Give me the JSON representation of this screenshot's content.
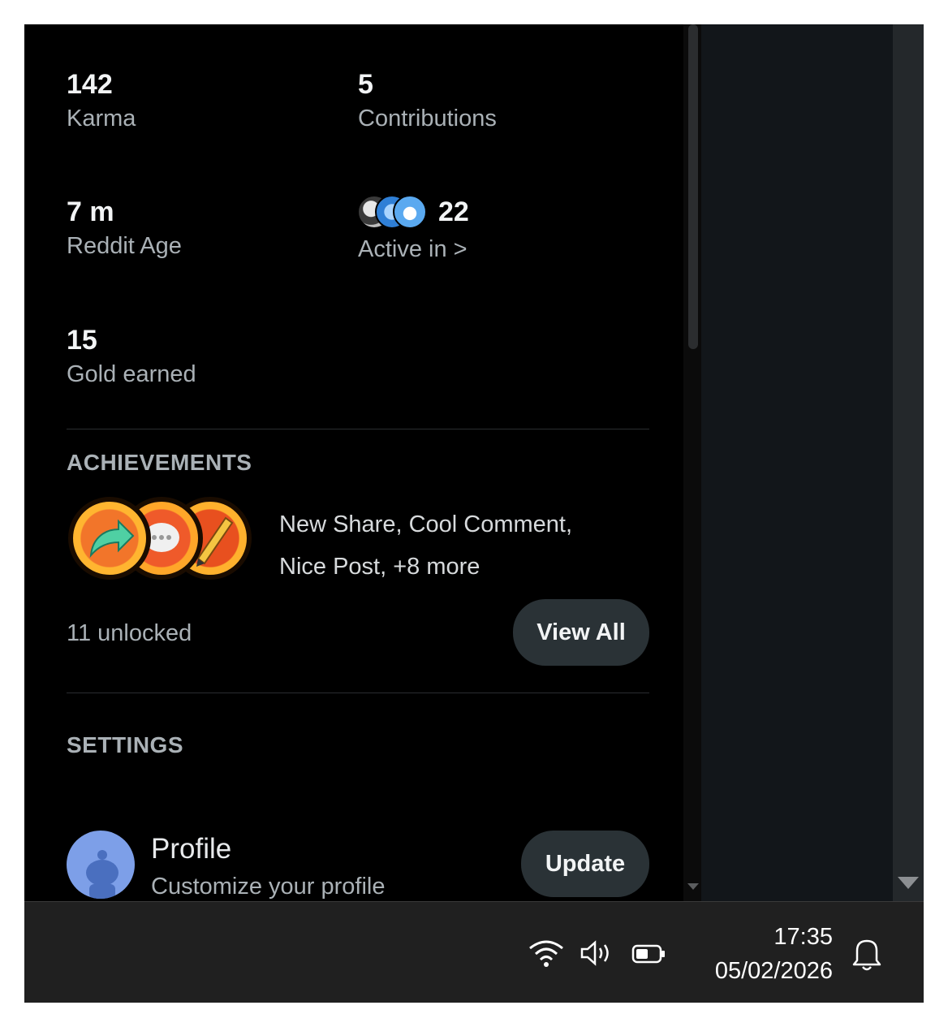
{
  "stats": {
    "karma": {
      "value": "142",
      "label": "Karma"
    },
    "contributions": {
      "value": "5",
      "label": "Contributions"
    },
    "reddit_age": {
      "value": "7 m",
      "label": "Reddit Age"
    },
    "active_in": {
      "value": "22",
      "label": "Active in >"
    },
    "gold_earned": {
      "value": "15",
      "label": "Gold earned"
    }
  },
  "achievements": {
    "title": "ACHIEVEMENTS",
    "names_line1": "New Share, Cool Comment,",
    "names_line2": "Nice Post, +8 more",
    "unlocked": "11 unlocked",
    "view_all_label": "View All",
    "badge_icons": [
      "share-badge-icon",
      "comment-badge-icon",
      "post-badge-icon"
    ]
  },
  "settings": {
    "title": "SETTINGS",
    "profile": {
      "title": "Profile",
      "subtitle": "Customize your profile",
      "button_label": "Update"
    }
  },
  "taskbar": {
    "time": "17:35",
    "date": "05/02/2026",
    "tray_icons": [
      "wifi-icon",
      "volume-icon",
      "battery-icon",
      "notification-bell-icon"
    ]
  },
  "colors": {
    "background": "#000000",
    "primary_text": "#f2f4f5",
    "secondary_text": "#aab1b6",
    "button_bg": "#2a3236",
    "taskbar_bg": "#202020"
  }
}
